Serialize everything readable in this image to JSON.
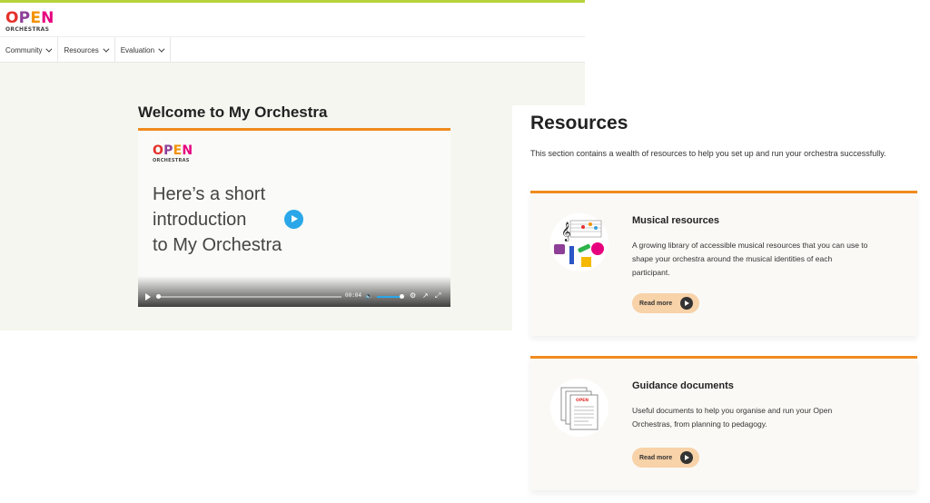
{
  "brand": {
    "logo_word": "OPEN",
    "logo_sub": "ORCHESTRAS",
    "logo_colors": [
      "#e4312b",
      "#8e3f97",
      "#f39200",
      "#e6007e"
    ],
    "accent_green": "#b6d43a",
    "accent_orange": "#f08b1e"
  },
  "nav": {
    "items": [
      {
        "label": "Community"
      },
      {
        "label": "Resources"
      },
      {
        "label": "Evaluation"
      }
    ]
  },
  "welcome": {
    "title": "Welcome to My Orchestra",
    "video": {
      "line1": "Here’s a short",
      "line2": "introduction",
      "line3": "to My Orchestra",
      "time": "00:04",
      "play_icon": "play-icon",
      "progress": 0.0,
      "volume": 0.9
    }
  },
  "resources": {
    "title": "Resources",
    "intro": "This section contains a wealth of resources to help you set up and run your orchestra successfully.",
    "cards": [
      {
        "title": "Musical resources",
        "description": "A growing library of accessible musical resources that you can use to shape your orchestra around the musical identities of each participant.",
        "button": "Read more",
        "icon": "music-shapes-icon"
      },
      {
        "title": "Guidance documents",
        "description": "Useful documents to help you organise and run your Open Orchestras, from planning to pedagogy.",
        "button": "Read more",
        "icon": "documents-icon"
      }
    ]
  }
}
